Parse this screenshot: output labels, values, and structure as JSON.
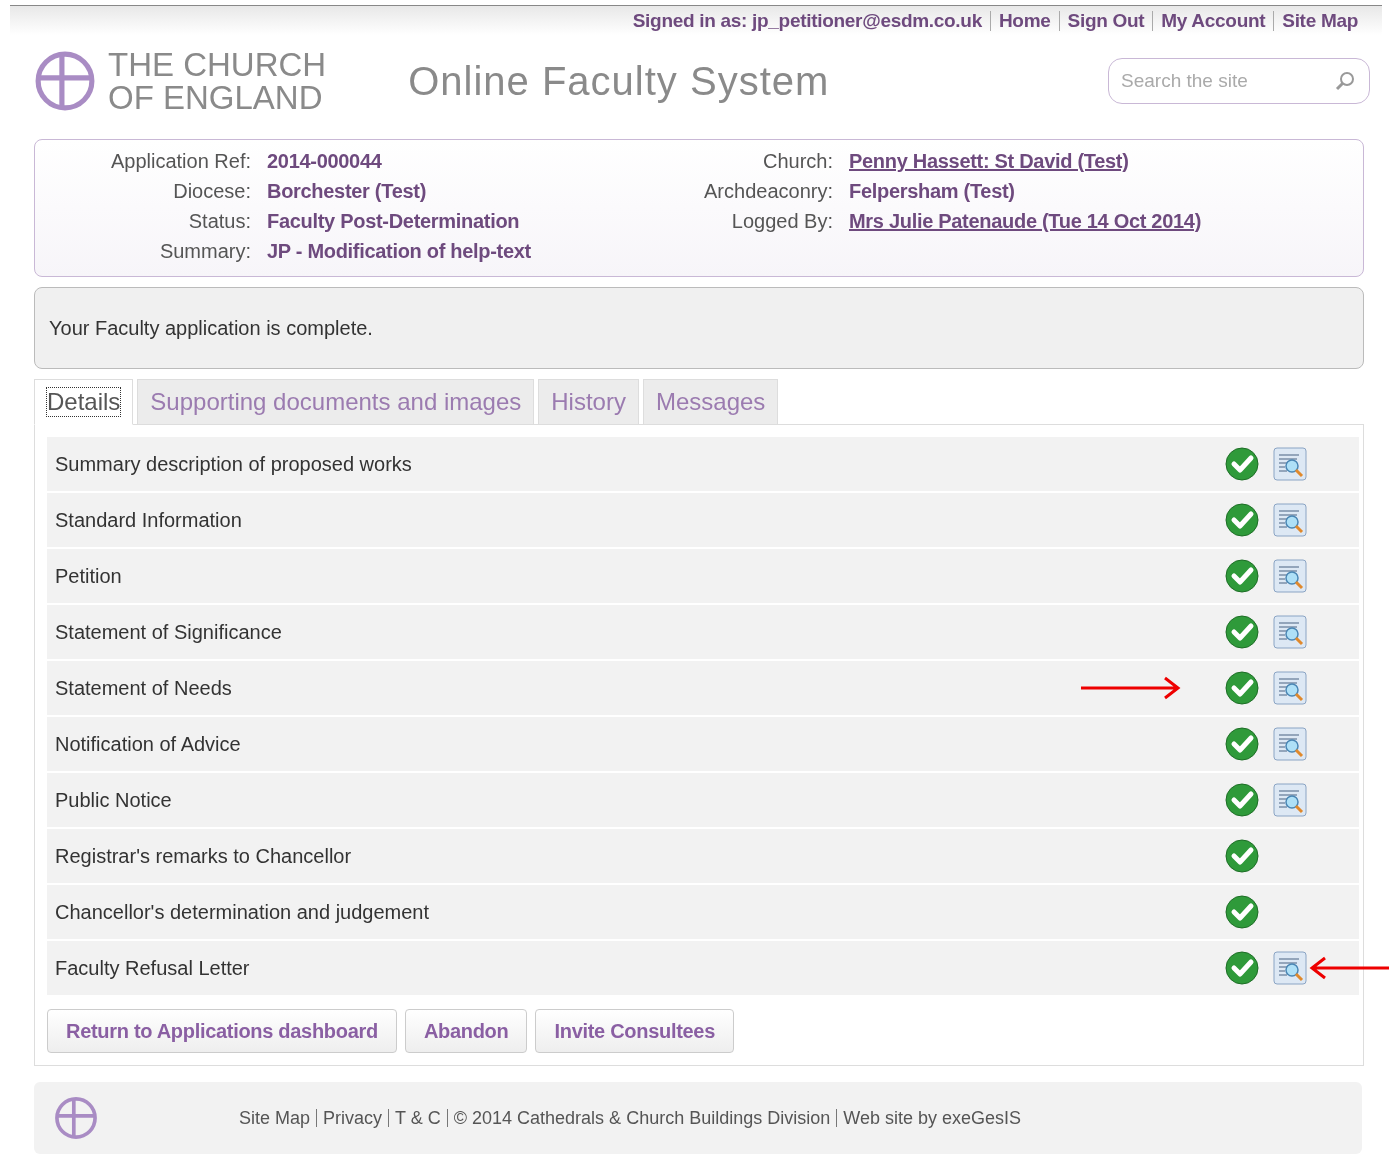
{
  "top_links": [
    {
      "text": "Signed in as: jp_petitioner@esdm.co.uk",
      "link": false
    },
    {
      "text": "Home",
      "link": true
    },
    {
      "text": "Sign Out",
      "link": true
    },
    {
      "text": "My Account",
      "link": true
    },
    {
      "text": "Site Map",
      "link": true
    }
  ],
  "logo": {
    "line1": "THE CHURCH",
    "line2": "OF ENGLAND"
  },
  "site_title": "Online Faculty System",
  "search": {
    "placeholder": "Search the site"
  },
  "info_left": [
    {
      "label": "Application Ref:",
      "value": "2014-000044",
      "link": false
    },
    {
      "label": "Diocese:",
      "value": "Borchester (Test)",
      "link": false
    },
    {
      "label": "Status:",
      "value": "Faculty Post-Determination",
      "link": false
    },
    {
      "label": "Summary:",
      "value": "JP - Modification of help-text",
      "link": false
    }
  ],
  "info_right": [
    {
      "label": "Church:",
      "value": "Penny Hassett: St David (Test)",
      "link": true
    },
    {
      "label": "Archdeaconry:",
      "value": "Felpersham (Test)",
      "link": false
    },
    {
      "label": "Logged By:",
      "value": "Mrs Julie Patenaude (Tue 14 Oct 2014)",
      "link": true
    }
  ],
  "message": "Your Faculty application is complete.",
  "tabs": [
    {
      "label": "Details",
      "selected": true
    },
    {
      "label": "Supporting documents and images",
      "selected": false
    },
    {
      "label": "History",
      "selected": false
    },
    {
      "label": "Messages",
      "selected": false
    }
  ],
  "sections": [
    {
      "title": "Summary description of proposed works",
      "complete": true,
      "viewable": true
    },
    {
      "title": "Standard Information",
      "complete": true,
      "viewable": true
    },
    {
      "title": "Petition",
      "complete": true,
      "viewable": true
    },
    {
      "title": "Statement of Significance",
      "complete": true,
      "viewable": true
    },
    {
      "title": "Statement of Needs",
      "complete": true,
      "viewable": true,
      "arrow_before": true
    },
    {
      "title": "Notification of Advice",
      "complete": true,
      "viewable": true
    },
    {
      "title": "Public Notice",
      "complete": true,
      "viewable": true
    },
    {
      "title": "Registrar's remarks to Chancellor",
      "complete": true,
      "viewable": false
    },
    {
      "title": "Chancellor's determination and judgement",
      "complete": true,
      "viewable": false
    },
    {
      "title": "Faculty Refusal Letter",
      "complete": true,
      "viewable": true,
      "arrow_after": true
    }
  ],
  "buttons": [
    "Return to Applications dashboard",
    "Abandon",
    "Invite Consultees"
  ],
  "footer_links": [
    "Site Map",
    "Privacy",
    "T & C",
    "© 2014 Cathedrals & Church Buildings Division",
    "Web site by exeGesIS"
  ]
}
